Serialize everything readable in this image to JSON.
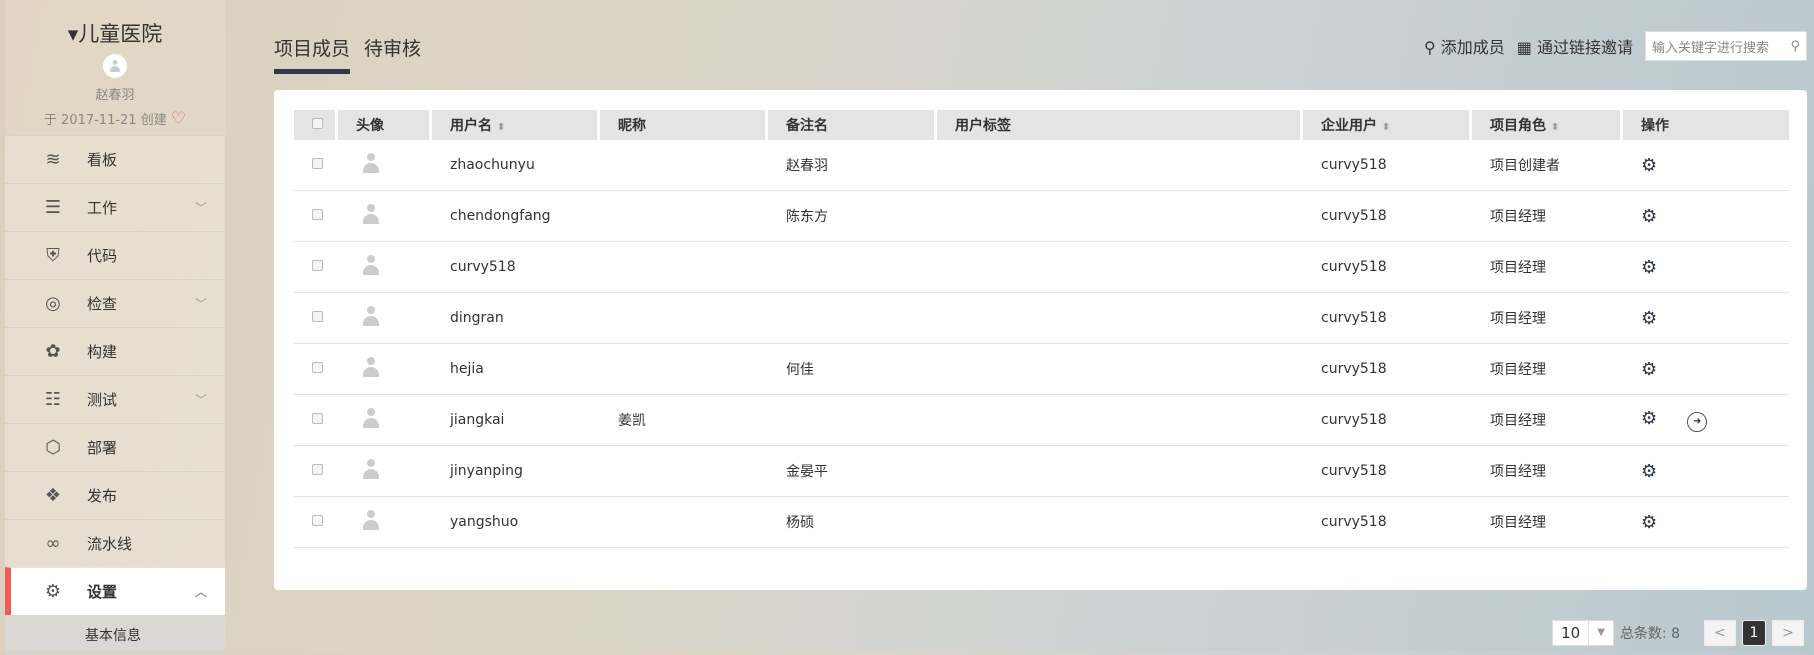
{
  "sidebar": {
    "project": "儿童医院",
    "user": "赵春羽",
    "created": "于 2017-11-21 创建",
    "items": [
      {
        "label": "看板",
        "icon": "layers-icon",
        "glyph": "≋"
      },
      {
        "label": "工作",
        "icon": "list-icon",
        "glyph": "☰",
        "chev": "﹀"
      },
      {
        "label": "代码",
        "icon": "code-shield-icon",
        "glyph": "⛨"
      },
      {
        "label": "检查",
        "icon": "radar-icon",
        "glyph": "◎",
        "chev": "﹀"
      },
      {
        "label": "构建",
        "icon": "gear-build-icon",
        "glyph": "✿"
      },
      {
        "label": "测试",
        "icon": "sliders-icon",
        "glyph": "☷",
        "chev": "﹀"
      },
      {
        "label": "部署",
        "icon": "box-icon",
        "glyph": "⬡"
      },
      {
        "label": "发布",
        "icon": "package-icon",
        "glyph": "❖"
      },
      {
        "label": "流水线",
        "icon": "pipeline-icon",
        "glyph": "∞"
      },
      {
        "label": "设置",
        "icon": "settings-icon",
        "glyph": "⚙",
        "chev": "︿"
      }
    ],
    "sub": "基本信息"
  },
  "tabs": [
    "项目成员",
    "待审核"
  ],
  "actions": {
    "add": "添加成员",
    "invite": "通过链接邀请",
    "search_placeholder": "输入关键字进行搜索"
  },
  "table": {
    "headers": [
      "头像",
      "用户名",
      "昵称",
      "备注名",
      "用户标签",
      "企业用户",
      "项目角色",
      "操作"
    ],
    "rows": [
      {
        "username": "zhaochunyu",
        "nick": "",
        "remark": "赵春羽",
        "tag": "",
        "corp": "curvy518",
        "role": "项目创建者"
      },
      {
        "username": "chendongfang",
        "nick": "",
        "remark": "陈东方",
        "tag": "",
        "corp": "curvy518",
        "role": "项目经理"
      },
      {
        "username": "curvy518",
        "nick": "",
        "remark": "",
        "tag": "",
        "corp": "curvy518",
        "role": "项目经理"
      },
      {
        "username": "dingran",
        "nick": "",
        "remark": "",
        "tag": "",
        "corp": "curvy518",
        "role": "项目经理"
      },
      {
        "username": "hejia",
        "nick": "",
        "remark": "何佳",
        "tag": "",
        "corp": "curvy518",
        "role": "项目经理"
      },
      {
        "username": "jiangkai",
        "nick": "姜凯",
        "remark": "",
        "tag": "",
        "corp": "curvy518",
        "role": "项目经理",
        "leave": true
      },
      {
        "username": "jinyanping",
        "nick": "",
        "remark": "金晏平",
        "tag": "",
        "corp": "curvy518",
        "role": "项目经理"
      },
      {
        "username": "yangshuo",
        "nick": "",
        "remark": "杨硕",
        "tag": "",
        "corp": "curvy518",
        "role": "项目经理"
      }
    ]
  },
  "pager": {
    "size": "10",
    "total": "总条数: 8",
    "page": "1"
  }
}
